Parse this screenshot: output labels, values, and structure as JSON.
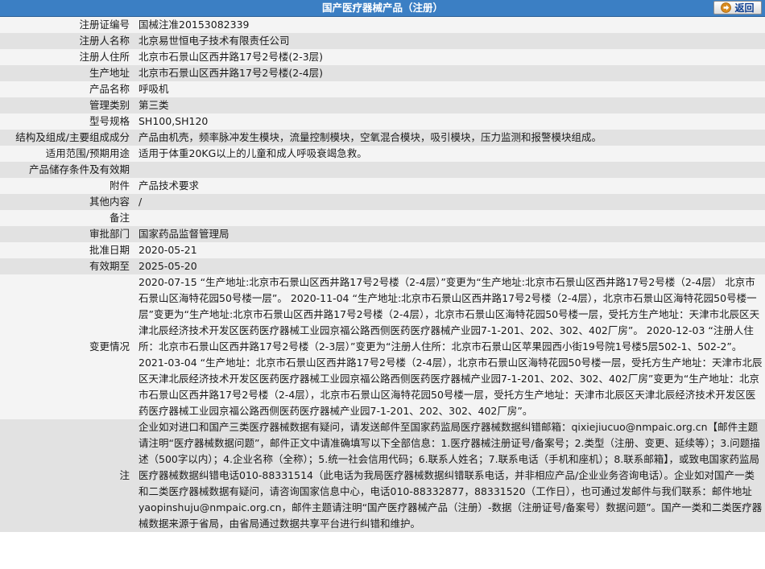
{
  "header": {
    "title": "国产医疗器械产品（注册）",
    "back_label": "返回"
  },
  "rows": [
    {
      "label": "注册证编号",
      "value": "国械注准20153082339"
    },
    {
      "label": "注册人名称",
      "value": "北京易世恒电子技术有限责任公司"
    },
    {
      "label": "注册人住所",
      "value": "北京市石景山区西井路17号2号楼(2-3层)"
    },
    {
      "label": "生产地址",
      "value": "北京市石景山区西井路17号2号楼(2-4层)"
    },
    {
      "label": "产品名称",
      "value": "呼吸机"
    },
    {
      "label": "管理类别",
      "value": "第三类"
    },
    {
      "label": "型号规格",
      "value": "SH100,SH120"
    },
    {
      "label": "结构及组成/主要组成成分",
      "value": "产品由机壳，频率脉冲发生模块，流量控制模块，空氧混合模块，吸引模块，压力监测和报警模块组成。"
    },
    {
      "label": "适用范围/预期用途",
      "value": "适用于体重20KG以上的儿童和成人呼吸衰竭急救。"
    },
    {
      "label": "产品储存条件及有效期",
      "value": ""
    },
    {
      "label": "附件",
      "value": "产品技术要求"
    },
    {
      "label": "其他内容",
      "value": "/"
    },
    {
      "label": "备注",
      "value": ""
    },
    {
      "label": "审批部门",
      "value": "国家药品监督管理局"
    },
    {
      "label": "批准日期",
      "value": "2020-05-21"
    },
    {
      "label": "有效期至",
      "value": "2025-05-20"
    },
    {
      "label": "变更情况",
      "value": "2020-07-15 “生产地址:北京市石景山区西井路17号2号楼（2-4层）”变更为“生产地址:北京市石景山区西井路17号2号楼（2-4层） 北京市石景山区海特花园50号楼一层”。 2020-11-04 “生产地址:北京市石景山区西井路17号2号楼（2-4层），北京市石景山区海特花园50号楼一层”变更为“生产地址:北京市石景山区西井路17号2号楼（2-4层），北京市石景山区海特花园50号楼一层，受托方生产地址：天津市北辰区天津北辰经济技术开发区医药医疗器械工业园京福公路西侧医药医疗器械产业园7-1-201、202、302、402厂房”。 2020-12-03 “注册人住所：北京市石景山区西井路17号2号楼（2-3层）”变更为“注册人住所：北京市石景山区苹果园西小街19号院1号楼5层502-1、502-2”。 2021-03-04 “生产地址：北京市石景山区西井路17号2号楼（2-4层），北京市石景山区海特花园50号楼一层，受托方生产地址：天津市北辰区天津北辰经济技术开发区医药医疗器械工业园京福公路西侧医药医疗器械产业园7-1-201、202、302、402厂房”变更为“生产地址：北京市石景山区西井路17号2号楼（2-4层），北京市石景山区海特花园50号楼一层，受托方生产地址：天津市北辰区天津北辰经济技术开发区医药医疗器械工业园京福公路西侧医药医疗器械产业园7-1-201、202、302、402厂房”。"
    },
    {
      "label": "注",
      "value": "企业如对进口和国产三类医疗器械数据有疑问，请发送邮件至国家药监局医疗器械数据纠错邮箱：qixiejiucuo@nmpaic.org.cn【邮件主题请注明“医疗器械数据问题”，邮件正文中请准确填写以下全部信息：1.医疗器械注册证号/备案号；2.类型（注册、变更、延续等）；3.问题描述（500字以内）；4.企业名称（全称）；5.统一社会信用代码；6.联系人姓名；7.联系电话（手机和座机）；8.联系邮箱】，或致电国家药监局医疗器械数据纠错电话010-88331514（此电话为我局医疗器械数据纠错联系电话，并非相应产品/企业业务咨询电话）。企业如对国产一类和二类医疗器械数据有疑问，请咨询国家信息中心，电话010-88332877，88331520（工作日），也可通过发邮件与我们联系：邮件地址yaopinshuju@nmpaic.org.cn，邮件主题请注明“国产医疗器械产品（注册）-数据（注册证号/备案号）数据问题”。国产一类和二类医疗器械数据来源于省局，由省局通过数据共享平台进行纠错和维护。"
    }
  ],
  "colors": {
    "header_bg": "#3b7fc4",
    "row_light": "#f4f4f4",
    "row_dark": "#e2e2e2"
  },
  "icons": {
    "back": "arrow-right-icon"
  }
}
